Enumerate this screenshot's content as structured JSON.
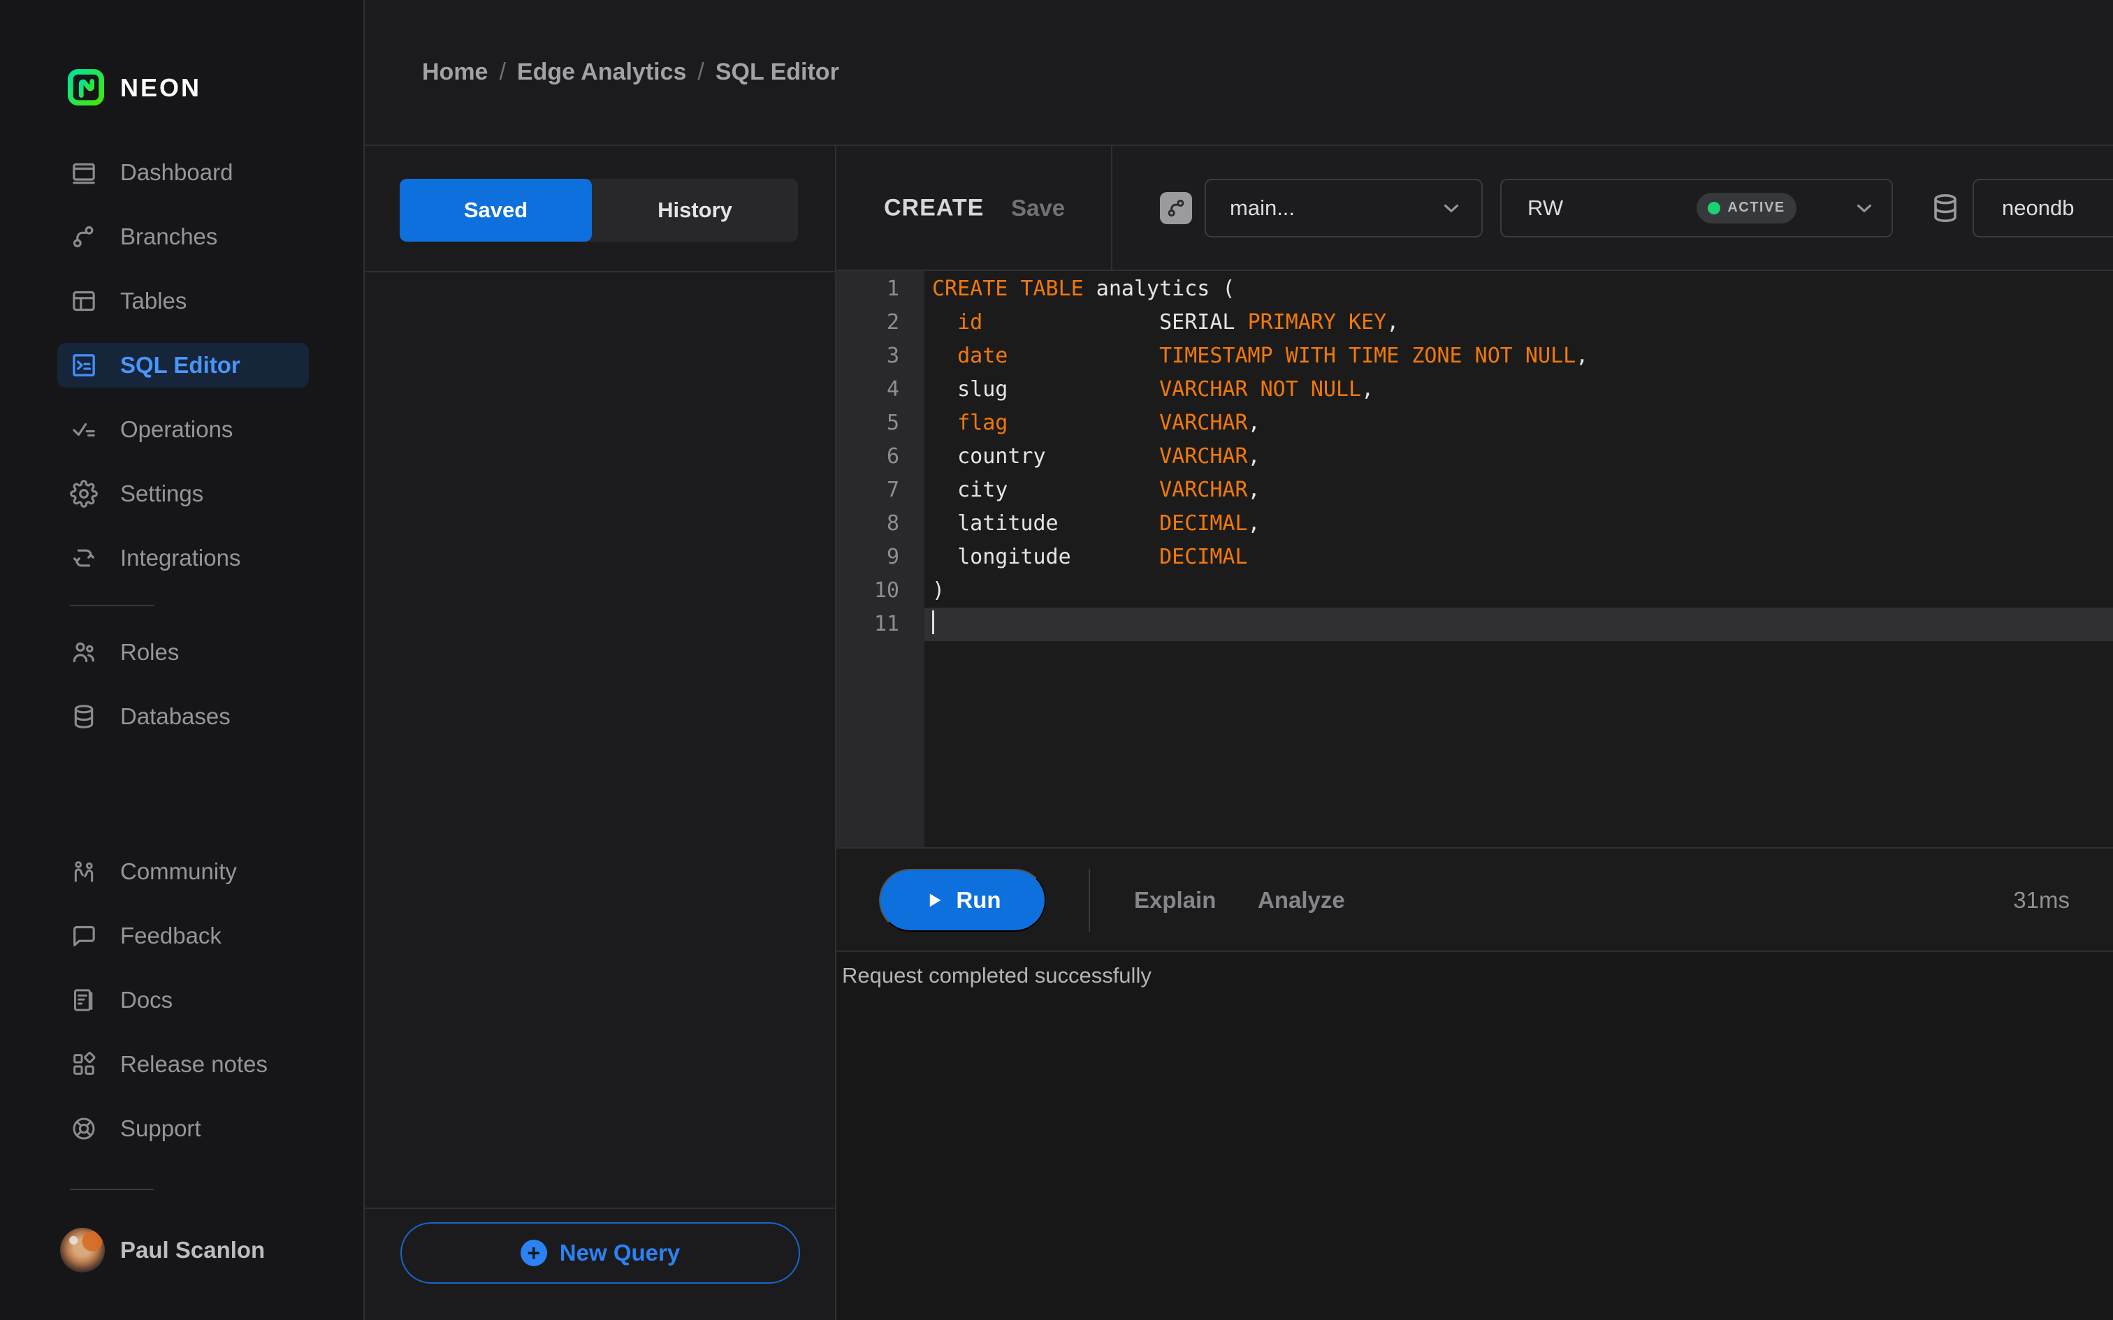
{
  "brand": {
    "name": "NEON"
  },
  "breadcrumb": {
    "separator": "/",
    "items": [
      "Home",
      "Edge Analytics",
      "SQL Editor"
    ]
  },
  "sidebar": {
    "items": [
      {
        "label": "Dashboard"
      },
      {
        "label": "Branches"
      },
      {
        "label": "Tables"
      },
      {
        "label": "SQL Editor",
        "active": true
      },
      {
        "label": "Operations"
      },
      {
        "label": "Settings"
      },
      {
        "label": "Integrations"
      },
      {
        "label": "Roles"
      },
      {
        "label": "Databases"
      },
      {
        "label": "Community"
      },
      {
        "label": "Feedback"
      },
      {
        "label": "Docs"
      },
      {
        "label": "Release notes"
      },
      {
        "label": "Support"
      }
    ],
    "user": {
      "name": "Paul Scanlon"
    }
  },
  "queries_panel": {
    "tabs": [
      {
        "label": "Saved",
        "active": true
      },
      {
        "label": "History",
        "active": false
      }
    ],
    "new_query_label": "New Query"
  },
  "toolbar": {
    "query_title": "CREATE",
    "save_label": "Save",
    "branch_select": {
      "value": "main..."
    },
    "compute_select": {
      "value": "RW",
      "status_badge": "ACTIVE"
    },
    "database_select": {
      "value": "neondb"
    }
  },
  "editor": {
    "language": "sql",
    "active_line": 11,
    "lines": [
      {
        "num": 1,
        "segments": [
          [
            "kw",
            "CREATE TABLE"
          ],
          [
            "pl",
            " analytics ("
          ]
        ]
      },
      {
        "num": 2,
        "segments": [
          [
            "pl",
            "  "
          ],
          [
            "kw",
            "id"
          ],
          [
            "pl",
            "              "
          ],
          [
            "pl",
            "SERIAL "
          ],
          [
            "kw",
            "PRIMARY KEY"
          ],
          [
            "pl",
            ","
          ]
        ]
      },
      {
        "num": 3,
        "segments": [
          [
            "pl",
            "  "
          ],
          [
            "kw",
            "date"
          ],
          [
            "pl",
            "            "
          ],
          [
            "kw",
            "TIMESTAMP WITH TIME ZONE NOT NULL"
          ],
          [
            "pl",
            ","
          ]
        ]
      },
      {
        "num": 4,
        "segments": [
          [
            "pl",
            "  slug            "
          ],
          [
            "kw",
            "VARCHAR NOT NULL"
          ],
          [
            "pl",
            ","
          ]
        ]
      },
      {
        "num": 5,
        "segments": [
          [
            "pl",
            "  "
          ],
          [
            "kw",
            "flag"
          ],
          [
            "pl",
            "            "
          ],
          [
            "kw",
            "VARCHAR"
          ],
          [
            "pl",
            ","
          ]
        ]
      },
      {
        "num": 6,
        "segments": [
          [
            "pl",
            "  country         "
          ],
          [
            "kw",
            "VARCHAR"
          ],
          [
            "pl",
            ","
          ]
        ]
      },
      {
        "num": 7,
        "segments": [
          [
            "pl",
            "  city            "
          ],
          [
            "kw",
            "VARCHAR"
          ],
          [
            "pl",
            ","
          ]
        ]
      },
      {
        "num": 8,
        "segments": [
          [
            "pl",
            "  latitude        "
          ],
          [
            "kw",
            "DECIMAL"
          ],
          [
            "pl",
            ","
          ]
        ]
      },
      {
        "num": 9,
        "segments": [
          [
            "pl",
            "  longitude       "
          ],
          [
            "kw",
            "DECIMAL"
          ]
        ]
      },
      {
        "num": 10,
        "segments": [
          [
            "pl",
            ")"
          ]
        ]
      },
      {
        "num": 11,
        "segments": []
      }
    ]
  },
  "run_bar": {
    "run_label": "Run",
    "explain_label": "Explain",
    "analyze_label": "Analyze",
    "duration": "31ms"
  },
  "results": {
    "message": "Request completed successfully"
  },
  "colors": {
    "accent_blue": "#0d70dd",
    "new_query_blue": "#2c82f2",
    "selected_item_blue": "#4796fd",
    "keyword_orange": "#f2790a",
    "status_green": "#1bd171",
    "logo_green_start": "#00e599",
    "logo_green_end": "#45e50b"
  }
}
